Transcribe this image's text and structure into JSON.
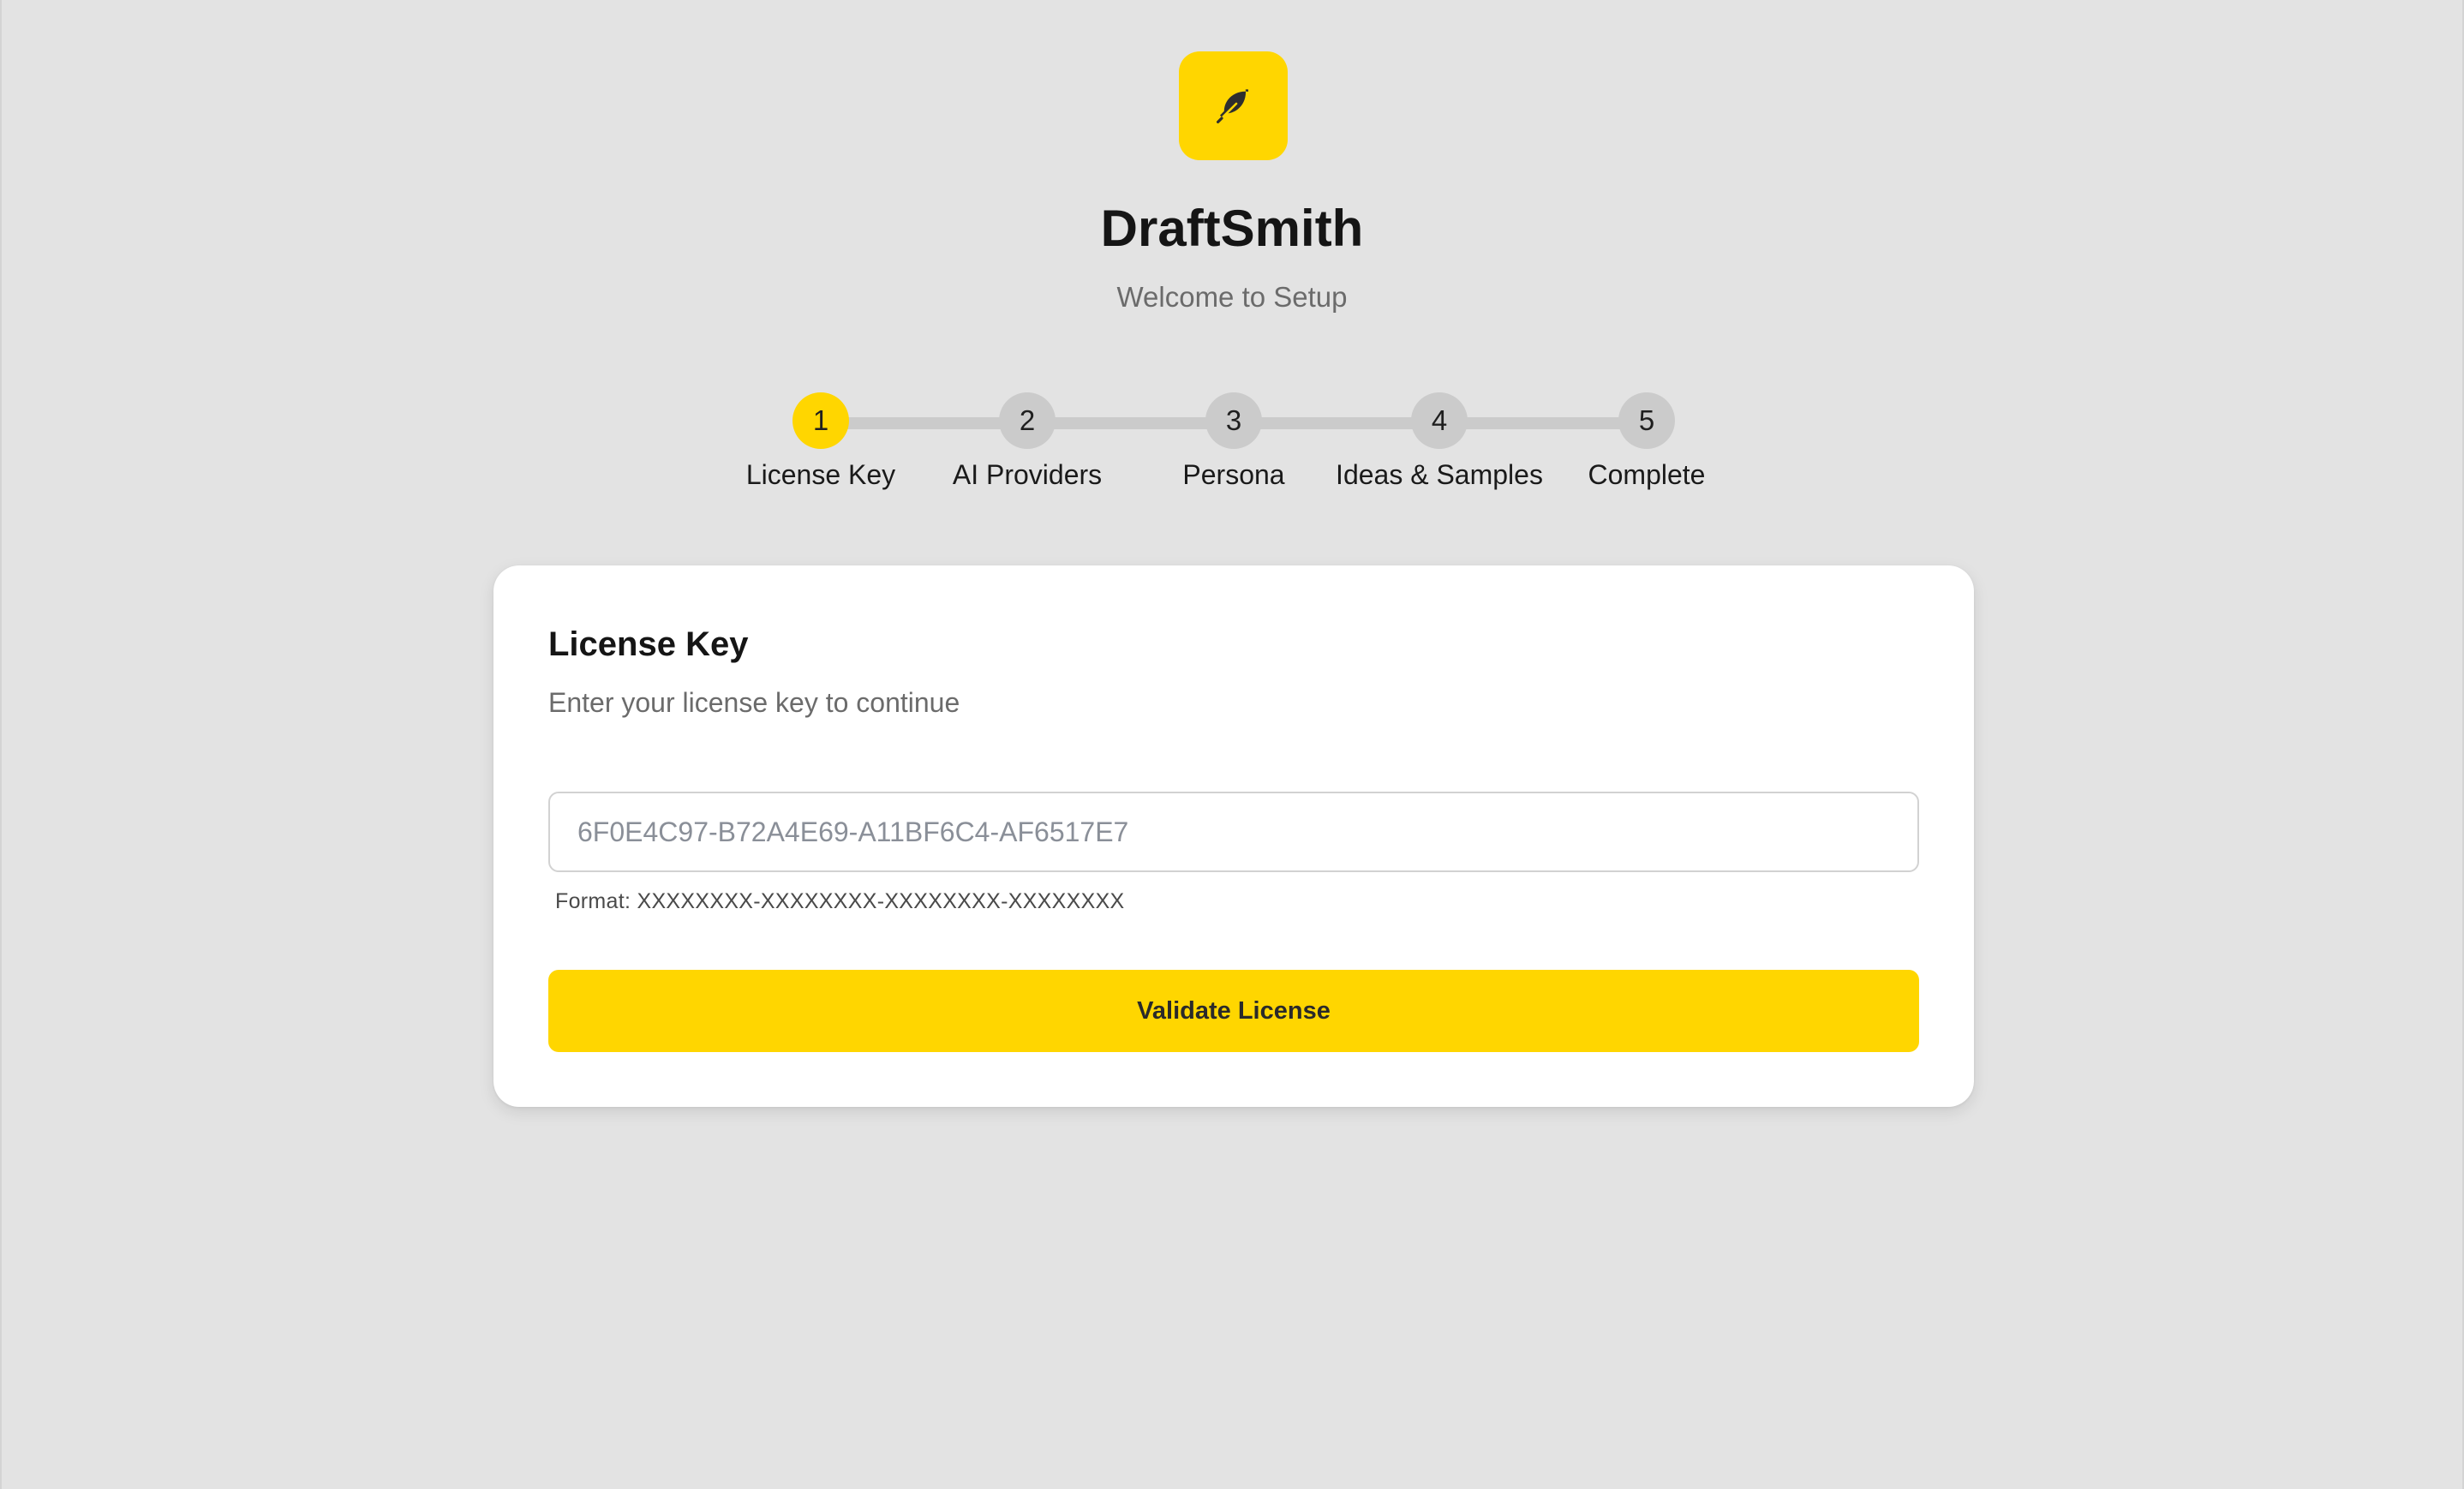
{
  "app": {
    "title": "DraftSmith",
    "subtitle": "Welcome to Setup",
    "logo_icon": "feather-icon",
    "accent_color": "#ffd600"
  },
  "stepper": {
    "current_step": 1,
    "steps": [
      {
        "number": "1",
        "label": "License Key"
      },
      {
        "number": "2",
        "label": "AI Providers"
      },
      {
        "number": "3",
        "label": "Persona"
      },
      {
        "number": "4",
        "label": "Ideas & Samples"
      },
      {
        "number": "5",
        "label": "Complete"
      }
    ]
  },
  "card": {
    "title": "License Key",
    "subtitle": "Enter your license key to continue",
    "license_input": {
      "value": "",
      "placeholder": "6F0E4C97-B72A4E69-A11BF6C4-AF6517E7"
    },
    "format_hint": "Format: XXXXXXXX-XXXXXXXX-XXXXXXXX-XXXXXXXX",
    "validate_label": "Validate License"
  }
}
